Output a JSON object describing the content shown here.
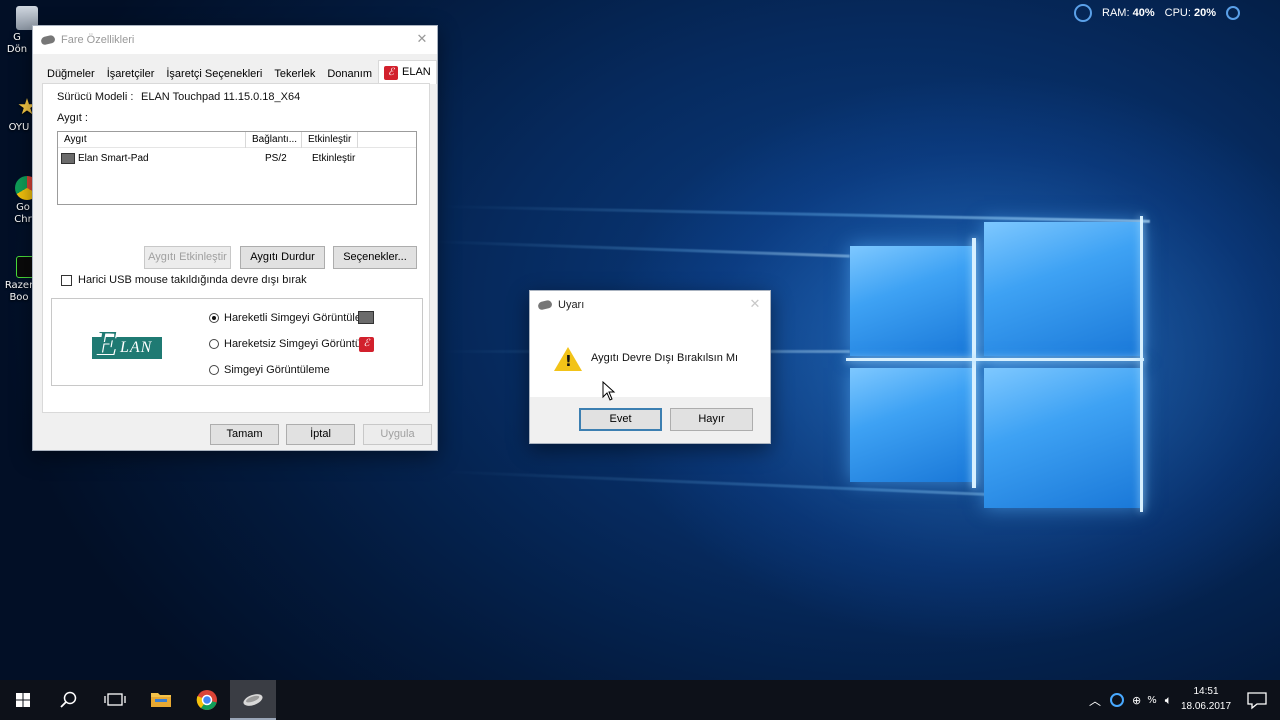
{
  "desktop": {
    "icons": [
      {
        "label": "G\nDön"
      },
      {
        "label": "OYU"
      },
      {
        "label": "Go\nChr"
      },
      {
        "label": "Razer\nBoo"
      }
    ]
  },
  "system_monitor": {
    "ram_label": "RAM:",
    "ram_value": "40%",
    "cpu_label": "CPU:",
    "cpu_value": "20%"
  },
  "mouse_dialog": {
    "title": "Fare Özellikleri",
    "tabs": [
      "Düğmeler",
      "İşaretçiler",
      "İşaretçi Seçenekleri",
      "Tekerlek",
      "Donanım",
      "ELAN"
    ],
    "active_tab": "ELAN",
    "driver_model_label": "Sürücü Modeli :",
    "driver_model_value": "ELAN Touchpad 11.15.0.18_X64",
    "device_label": "Aygıt :",
    "columns": [
      "Aygıt",
      "Bağlantı...",
      "Etkinleştir"
    ],
    "devices": [
      {
        "name": "Elan Smart-Pad",
        "connection": "PS/2",
        "enabled": "Etkinleştir"
      }
    ],
    "enable_device_button": "Aygıtı Etkinleştir",
    "disable_device_button": "Aygıtı Durdur",
    "options_button": "Seçenekler...",
    "usb_checkbox_label": "Harici USB mouse takıldığında devre dışı bırak",
    "tray_icon_options": [
      {
        "label": "Hareketli Simgeyi Görüntüle",
        "selected": true
      },
      {
        "label": "Hareketsiz Simgeyi Görüntüle",
        "selected": false
      },
      {
        "label": "Simgeyi Görüntüleme",
        "selected": false
      }
    ],
    "logo_text": "LAN",
    "logo_letter": "E",
    "ok_button": "Tamam",
    "cancel_button": "İptal",
    "apply_button": "Uygula"
  },
  "warning_dialog": {
    "title": "Uyarı",
    "message": "Aygıtı Devre Dışı Bırakılsın Mı",
    "yes_button": "Evet",
    "no_button": "Hayır"
  },
  "taskbar": {
    "time": "14:51",
    "date": "18.06.2017",
    "ime_label": "%"
  },
  "colors": {
    "accent": "#0078d7",
    "elan_red": "#d2202c",
    "elan_green": "#1f7a73",
    "warning_yellow": "#f2c318",
    "taskbar": "#0d1119"
  }
}
